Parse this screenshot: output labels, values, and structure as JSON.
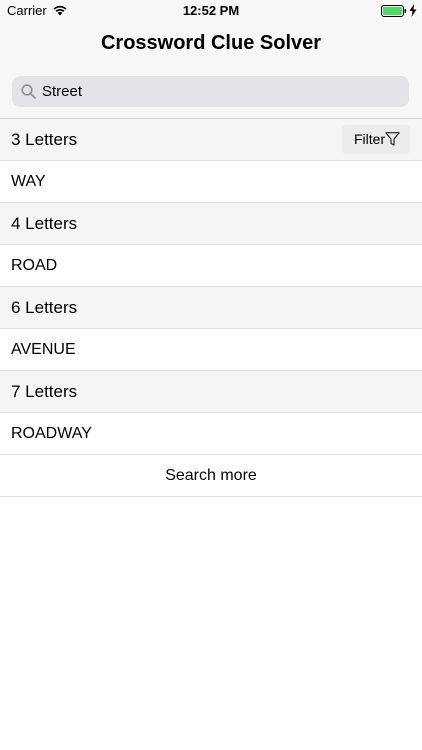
{
  "status_bar": {
    "carrier": "Carrier",
    "time": "12:52 PM",
    "battery_color": "#4cd964"
  },
  "nav": {
    "title": "Crossword Clue Solver"
  },
  "search": {
    "value": "Street",
    "icon": "search-icon"
  },
  "filter": {
    "label": "Filter",
    "icon": "funnel-icon"
  },
  "sections": [
    {
      "header": "3 Letters",
      "answers": [
        "WAY"
      ]
    },
    {
      "header": "4 Letters",
      "answers": [
        "ROAD"
      ]
    },
    {
      "header": "6 Letters",
      "answers": [
        "AVENUE"
      ]
    },
    {
      "header": "7 Letters",
      "answers": [
        "ROADWAY"
      ]
    }
  ],
  "search_more": {
    "label": "Search more"
  }
}
